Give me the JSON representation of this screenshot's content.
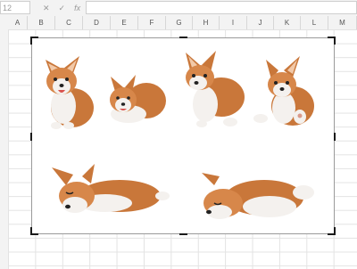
{
  "formula_bar": {
    "name_box": "12",
    "cancel_icon": "close-icon",
    "enter_icon": "checkmark-icon",
    "function_icon": "fx-icon",
    "formula_value": ""
  },
  "columns": [
    "A",
    "B",
    "C",
    "D",
    "E",
    "F",
    "G",
    "H",
    "I",
    "J",
    "K",
    "L",
    "M"
  ],
  "picture": {
    "description_icons": [
      "corgi-sitting-icon",
      "corgi-lying-icon",
      "corgi-standing-icon",
      "corgi-sitting-paw-icon",
      "corgi-sleeping-icon",
      "corgi-sleeping-icon"
    ],
    "colors": {
      "fur": "#c9773a",
      "white": "#f4f1ee",
      "outline": "#1a1a1a"
    }
  }
}
